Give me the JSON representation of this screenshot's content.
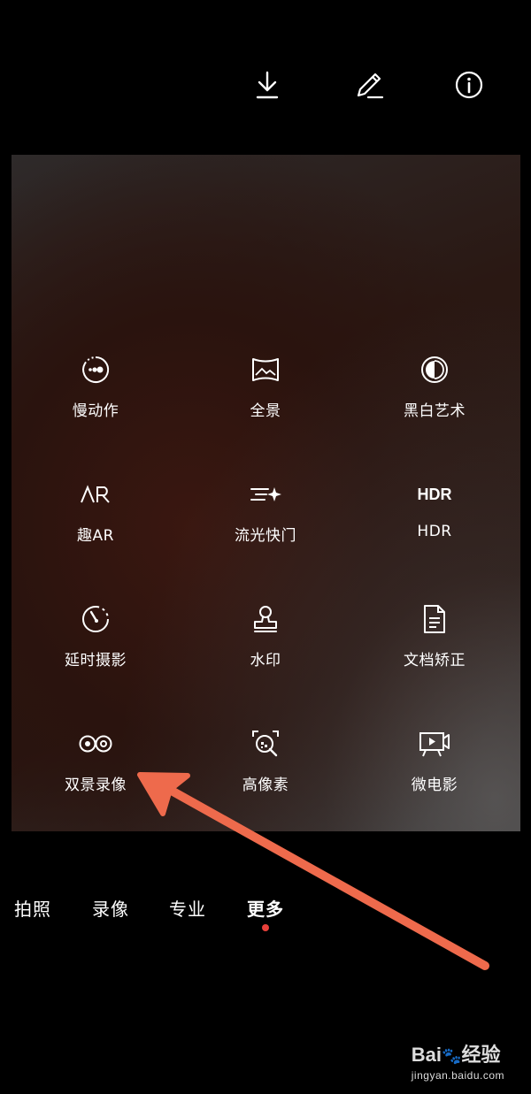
{
  "topbar": {
    "icons": [
      "download-icon",
      "edit-pencil-icon",
      "info-icon"
    ]
  },
  "modes": [
    {
      "label": "慢动作",
      "icon": "slow-motion-icon"
    },
    {
      "label": "全景",
      "icon": "panorama-icon"
    },
    {
      "label": "黑白艺术",
      "icon": "monochrome-icon"
    },
    {
      "label": "趣AR",
      "icon": "ar-icon",
      "icon_text": "AR"
    },
    {
      "label": "流光快门",
      "icon": "light-painting-icon"
    },
    {
      "label": "HDR",
      "icon": "hdr-icon",
      "icon_text": "HDR"
    },
    {
      "label": "延时摄影",
      "icon": "timelapse-icon"
    },
    {
      "label": "水印",
      "icon": "watermark-stamp-icon"
    },
    {
      "label": "文档矫正",
      "icon": "document-icon"
    },
    {
      "label": "双景录像",
      "icon": "dual-view-icon"
    },
    {
      "label": "高像素",
      "icon": "high-resolution-icon"
    },
    {
      "label": "微电影",
      "icon": "micro-movie-icon"
    }
  ],
  "tabs": [
    {
      "label": "拍照"
    },
    {
      "label": "录像"
    },
    {
      "label": "专业"
    },
    {
      "label": "更多",
      "active": true
    }
  ],
  "colors": {
    "active_dot": "#e8403a",
    "arrow": "#ee6a4c"
  },
  "watermark": {
    "brand": "Bai",
    "brand2": "经验",
    "url": "jingyan.baidu.com"
  }
}
